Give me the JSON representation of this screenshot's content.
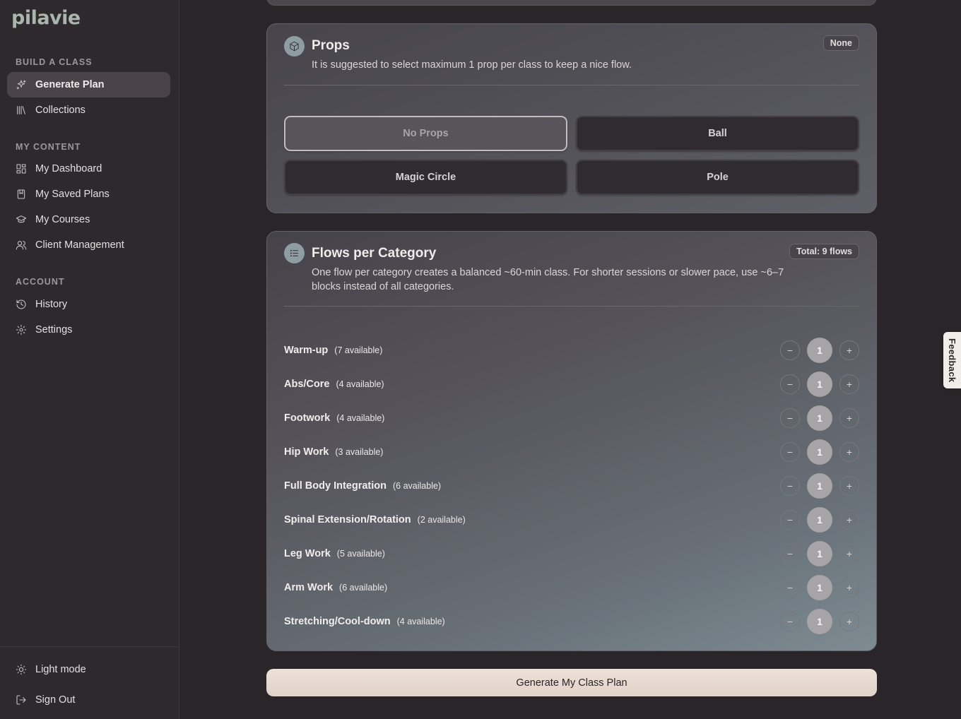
{
  "brand": {
    "logo": "pilavie"
  },
  "sidebar": {
    "sections": [
      {
        "label": "BUILD A CLASS",
        "items": [
          {
            "label": "Generate Plan",
            "icon": "sparkles-icon",
            "active": true
          },
          {
            "label": "Collections",
            "icon": "library-icon",
            "active": false
          }
        ]
      },
      {
        "label": "MY CONTENT",
        "items": [
          {
            "label": "My Dashboard",
            "icon": "dashboard-icon",
            "active": false
          },
          {
            "label": "My Saved Plans",
            "icon": "bookmark-icon",
            "active": false
          },
          {
            "label": "My Courses",
            "icon": "graduation-cap-icon",
            "active": false
          },
          {
            "label": "Client Management",
            "icon": "users-icon",
            "active": false
          }
        ]
      },
      {
        "label": "ACCOUNT",
        "items": [
          {
            "label": "History",
            "icon": "history-icon",
            "active": false
          },
          {
            "label": "Settings",
            "icon": "gear-icon",
            "active": false
          }
        ]
      }
    ],
    "footer": [
      {
        "label": "Light mode",
        "icon": "sun-icon"
      },
      {
        "label": "Sign Out",
        "icon": "sign-out-icon"
      }
    ]
  },
  "props": {
    "title": "Props",
    "description": "It is suggested to select maximum 1 prop per class to keep a nice flow.",
    "badge": "None",
    "options": [
      {
        "label": "No Props",
        "selected": true
      },
      {
        "label": "Ball",
        "selected": false
      },
      {
        "label": "Magic Circle",
        "selected": false
      },
      {
        "label": "Pole",
        "selected": false
      }
    ]
  },
  "flows": {
    "title": "Flows per Category",
    "description_line1": "One flow per category creates a balanced ~60-min class. For shorter sessions or slower pace, use ~6–7",
    "description_line2": "blocks instead of all categories.",
    "badge": "Total: 9 flows",
    "categories": [
      {
        "name": "Warm-up",
        "available": "(7 available)",
        "count": "1"
      },
      {
        "name": "Abs/Core",
        "available": "(4 available)",
        "count": "1"
      },
      {
        "name": "Footwork",
        "available": "(4 available)",
        "count": "1"
      },
      {
        "name": "Hip Work",
        "available": "(3 available)",
        "count": "1"
      },
      {
        "name": "Full Body Integration",
        "available": "(6 available)",
        "count": "1"
      },
      {
        "name": "Spinal Extension/Rotation",
        "available": "(2 available)",
        "count": "1"
      },
      {
        "name": "Leg Work",
        "available": "(5 available)",
        "count": "1"
      },
      {
        "name": "Arm Work",
        "available": "(6 available)",
        "count": "1"
      },
      {
        "name": "Stretching/Cool-down",
        "available": "(4 available)",
        "count": "1"
      }
    ],
    "decrement_symbol": "−",
    "increment_symbol": "+"
  },
  "actions": {
    "generate_label": "Generate My Class Plan"
  },
  "feedback": {
    "label": "Feedback"
  }
}
